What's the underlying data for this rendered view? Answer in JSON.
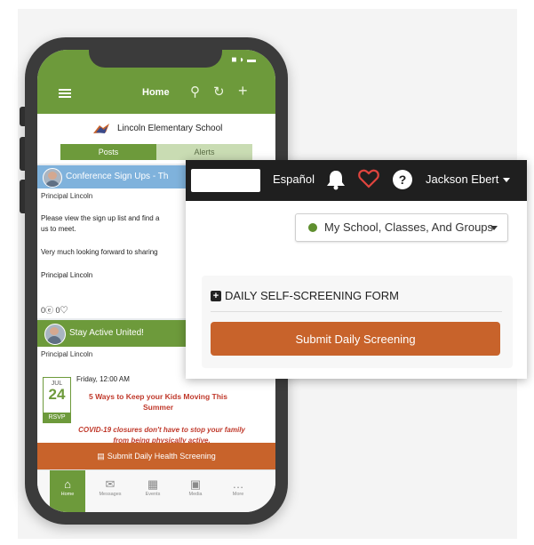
{
  "mobile": {
    "header": {
      "title": "Home",
      "status": "■ ◗ ▬"
    },
    "school": {
      "name": "Lincoln Elementary School"
    },
    "tabs": [
      {
        "label": "Posts"
      },
      {
        "label": "Alerts"
      }
    ],
    "post1": {
      "title": "Conference Sign Ups - Th",
      "author": "Principal Lincoln",
      "body1": "Please view the sign up list and find a",
      "body1b": "us to meet.",
      "body2": "Very much looking forward to sharing",
      "signoff": "Principal Lincoln",
      "reactions": "0ⓔ 0♡"
    },
    "post2": {
      "title": "Stay Active United!",
      "author": "Principal Lincoln",
      "date_month": "JUL",
      "date_day": "24",
      "rsvp": "RSVP",
      "time": "Friday, 12:00 AM",
      "event_title": "5 Ways to Keep your Kids Moving This Summer",
      "event_desc": "COVID-19 closures don't have to stop your family from being physically active."
    },
    "submit_bar": "Submit Daily Health Screening",
    "nav": [
      {
        "label": "Home",
        "icon": "⌂"
      },
      {
        "label": "Messages",
        "icon": "✉"
      },
      {
        "label": "Events",
        "icon": "▦"
      },
      {
        "label": "Media",
        "icon": "▣"
      },
      {
        "label": "More",
        "icon": "…"
      }
    ]
  },
  "desktop": {
    "topbar": {
      "language": "Español",
      "help": "?",
      "user": "Jackson Ebert"
    },
    "school_select": {
      "label": "My School, Classes, And Groups"
    },
    "form": {
      "title": "DAILY SELF-SCREENING FORM",
      "button": "Submit Daily Screening"
    }
  },
  "colors": {
    "brand_green": "#6d9a3b",
    "accent_orange": "#c8632b",
    "post_blue": "#7fb2dc",
    "heart_red": "#e0443e"
  }
}
